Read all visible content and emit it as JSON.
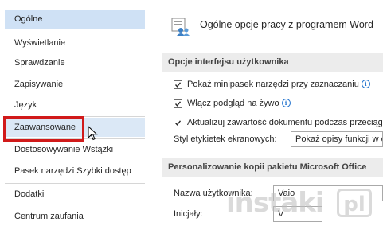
{
  "sidebar": {
    "items": [
      {
        "label": "Ogólne"
      },
      {
        "label": "Wyświetlanie"
      },
      {
        "label": "Sprawdzanie"
      },
      {
        "label": "Zapisywanie"
      },
      {
        "label": "Język"
      },
      {
        "label": "Zaawansowane"
      },
      {
        "label": "Dostosowywanie Wstążki"
      },
      {
        "label": "Pasek narzędzi Szybki dostęp"
      },
      {
        "label": "Dodatki"
      },
      {
        "label": "Centrum zaufania"
      }
    ],
    "selected_index": 0,
    "highlighted_item": "Zaawansowane"
  },
  "main": {
    "title": "Ogólne opcje pracy z programem Word",
    "ui_section": {
      "heading": "Opcje interfejsu użytkownika",
      "options": [
        {
          "label": "Pokaż minipasek narzędzi przy zaznaczaniu",
          "checked": true,
          "info": "i"
        },
        {
          "label": "Włącz podgląd na żywo",
          "checked": true,
          "info": "i"
        },
        {
          "label": "Aktualizuj zawartość dokumentu podczas przeciągania",
          "checked": true
        }
      ],
      "tooltip_style_label": "Styl etykietek ekranowych:",
      "tooltip_style_value": "Pokaż opisy funkcji w etykietkach ekranowych"
    },
    "personalize_section": {
      "heading": "Personalizowanie kopii pakietu Microsoft Office",
      "username_label": "Nazwa użytkownika:",
      "username_value": "Vaio",
      "initials_label": "Inicjały:",
      "initials_value": "V"
    }
  },
  "watermark": {
    "text": "instaki",
    "badge": "pl"
  },
  "colors": {
    "selected": "#cfe1f5",
    "highlight_border": "#d11a1a",
    "section_bg": "#ececec"
  }
}
